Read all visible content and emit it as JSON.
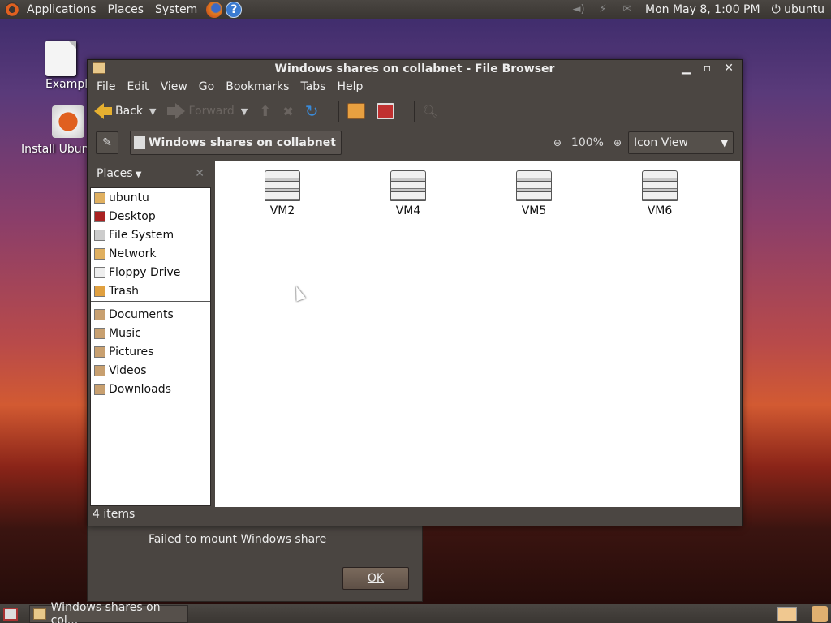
{
  "top_panel": {
    "applications": "Applications",
    "places": "Places",
    "system": "System",
    "help_glyph": "?",
    "clock": "Mon May  8,  1:00 PM",
    "user": "ubuntu"
  },
  "desktop": {
    "icon1_label": "Exampl",
    "icon2_label": "Install Ubun"
  },
  "window": {
    "title": "Windows shares on collabnet - File Browser",
    "menu": [
      "File",
      "Edit",
      "View",
      "Go",
      "Bookmarks",
      "Tabs",
      "Help"
    ],
    "toolbar": {
      "back": "Back",
      "forward": "Forward"
    },
    "location": "Windows shares on collabnet",
    "zoom": "100%",
    "view": "Icon View",
    "sidebar": {
      "header": "Places",
      "items": [
        {
          "label": "ubuntu",
          "color": "#e0b060"
        },
        {
          "label": "Desktop",
          "color": "#aa2222"
        },
        {
          "label": "File System",
          "color": "#cccccc"
        },
        {
          "label": "Network",
          "color": "#e0b060"
        },
        {
          "label": "Floppy Drive",
          "color": "#eeeeee"
        },
        {
          "label": "Trash",
          "color": "#e0a040"
        }
      ],
      "bookmarks": [
        {
          "label": "Documents",
          "color": "#c8a070"
        },
        {
          "label": "Music",
          "color": "#c8a070"
        },
        {
          "label": "Pictures",
          "color": "#c8a070"
        },
        {
          "label": "Videos",
          "color": "#c8a070"
        },
        {
          "label": "Downloads",
          "color": "#c8a070"
        }
      ]
    },
    "files": [
      "VM2",
      "VM4",
      "VM5",
      "VM6"
    ],
    "status": "4 items"
  },
  "dialog": {
    "message": "Failed to mount Windows share",
    "ok": "OK"
  },
  "taskbar": {
    "task": "Windows shares on col..."
  }
}
